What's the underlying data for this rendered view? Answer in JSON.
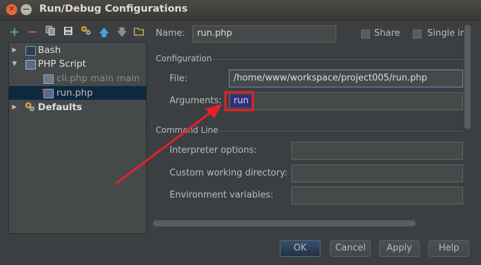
{
  "window": {
    "title": "Run/Debug Configurations"
  },
  "toolbar": {
    "buttons": [
      {
        "icon": "add-icon",
        "glyph": "+",
        "color": "#59a869"
      },
      {
        "icon": "remove-icon",
        "glyph": "−",
        "color": "#d9534f"
      },
      {
        "icon": "copy-icon",
        "glyph": "❐",
        "color": "#bbbbbb"
      },
      {
        "icon": "save-icon",
        "glyph": "▣",
        "color": "#bbbbbb"
      },
      {
        "icon": "edit-defaults-icon",
        "glyph": "✱",
        "color": "#d4a53a"
      },
      {
        "icon": "move-up-icon",
        "glyph": "⬆",
        "color": "#4a9fe0"
      },
      {
        "icon": "move-down-icon",
        "glyph": "⬇",
        "color": "#8c8c8c"
      },
      {
        "icon": "folder-icon",
        "glyph": "▭",
        "color": "#c7a25b"
      }
    ]
  },
  "tree": {
    "bash": "Bash",
    "php_script": "PHP Script",
    "cli_main": "cli.php main main",
    "run_php": "run.php",
    "defaults": "Defaults"
  },
  "form": {
    "name_label": "Name:",
    "name_value": "run.php",
    "share_label": "Share",
    "single_instance_label": "Single ir",
    "configuration_section": "Configuration",
    "file_label": "File:",
    "file_value": "/home/www/workspace/project005/run.php",
    "arguments_label": "Arguments:",
    "arguments_value": "run",
    "command_line_section": "Command Line",
    "interpreter_label": "Interpreter options:",
    "interpreter_value": "",
    "working_dir_label": "Custom working directory:",
    "working_dir_value": "",
    "env_label": "Environment variables:",
    "env_value": ""
  },
  "buttons": {
    "ok": "OK",
    "cancel": "Cancel",
    "apply": "Apply",
    "help": "Help"
  },
  "colors": {
    "annotation": "#e8202a",
    "selection": "#0d293e",
    "arg_highlight": "#2f2f7d"
  }
}
